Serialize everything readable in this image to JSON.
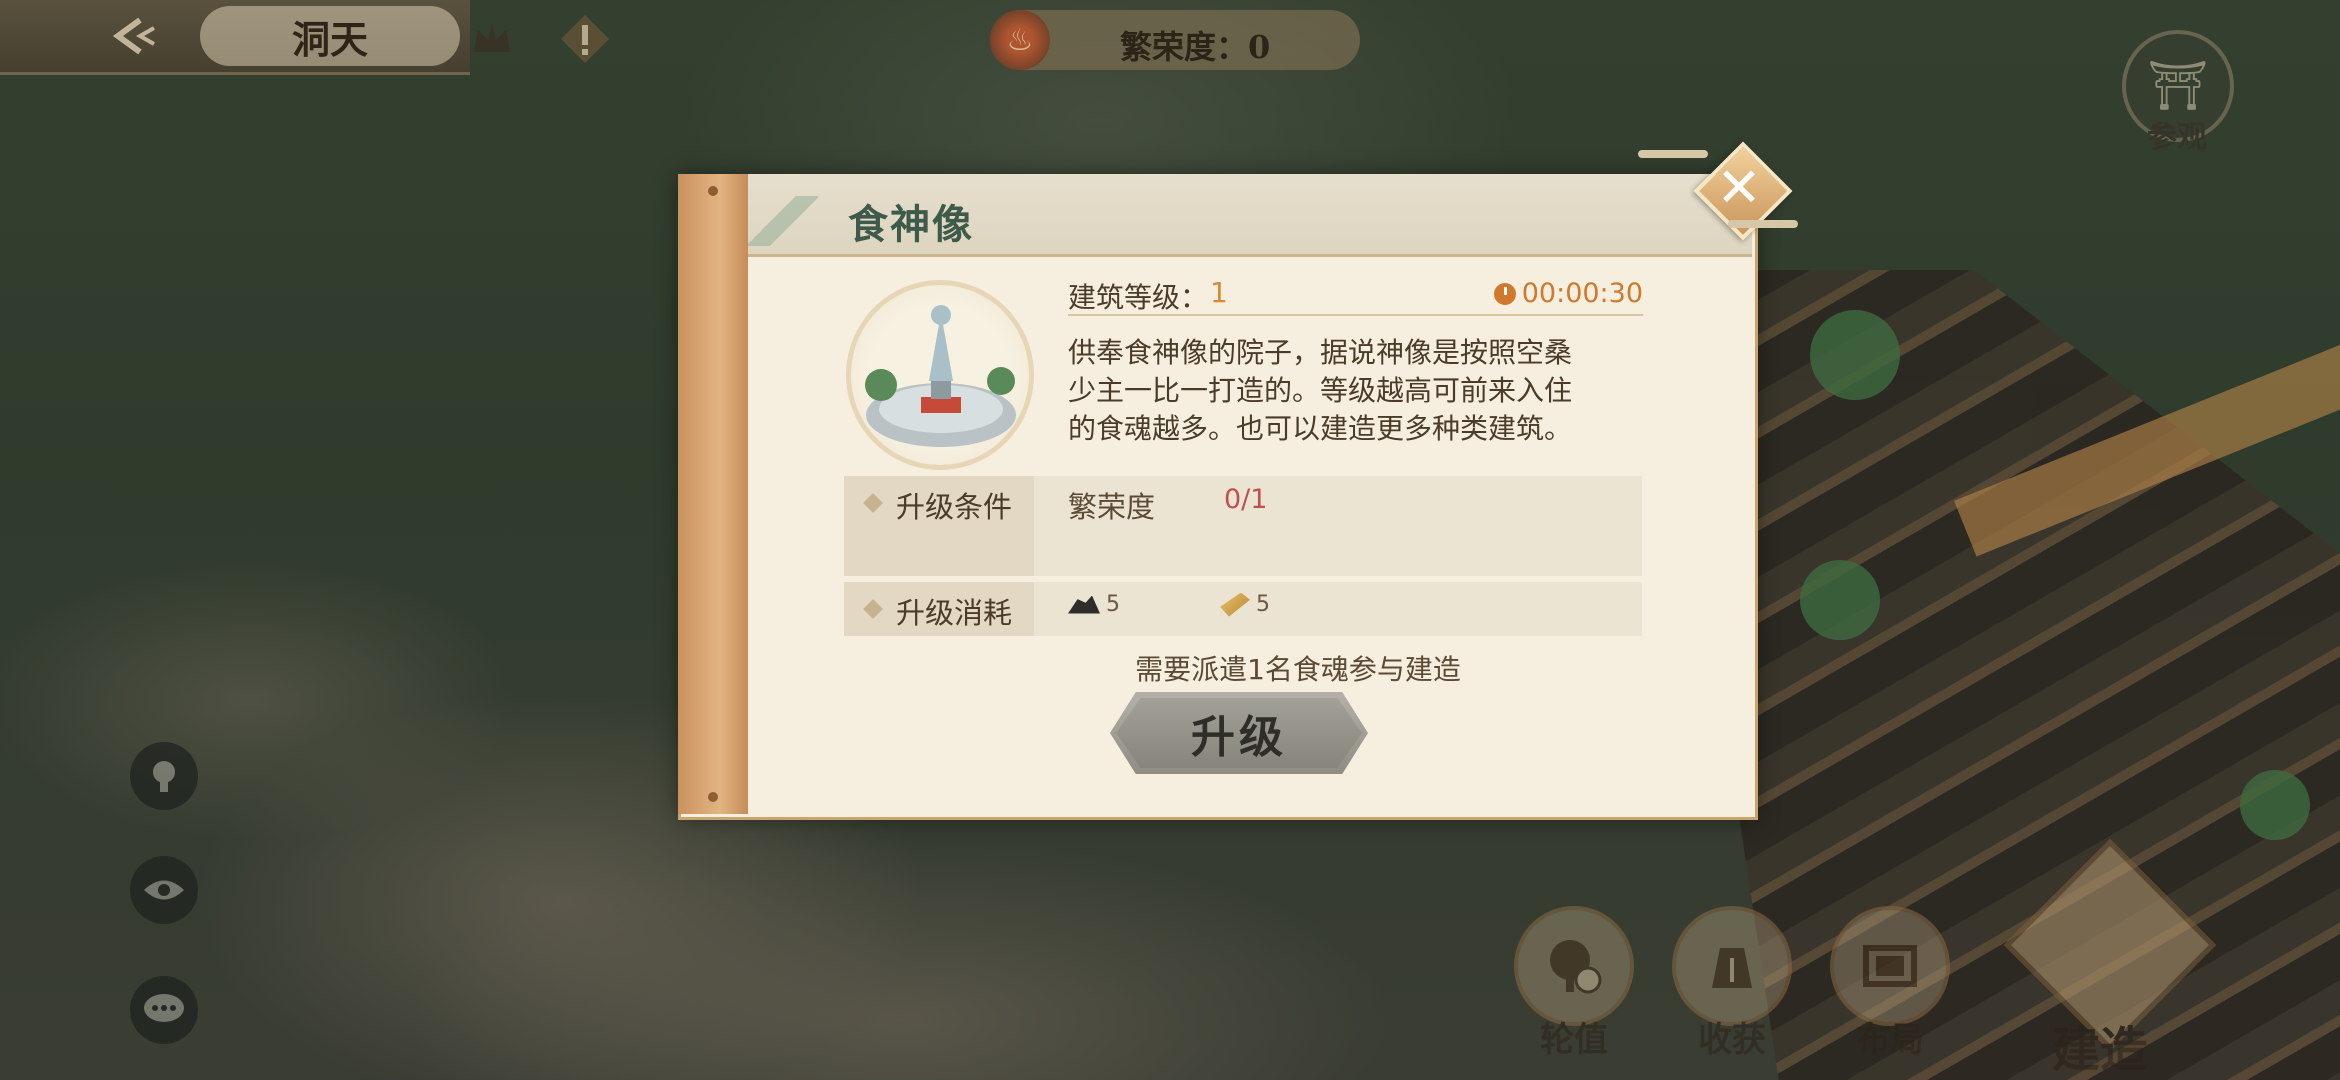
{
  "topbar": {
    "title": "洞天",
    "prosperity_text": "繁荣度：0",
    "visit_label": "参观",
    "icons": [
      "back-arrow-icon",
      "crown-icon",
      "alert-icon",
      "flame-icon",
      "gate-icon"
    ]
  },
  "side_buttons": [
    "avatar-icon",
    "eye-icon",
    "chat-icon"
  ],
  "bottom_menu": {
    "items": [
      {
        "label": "轮值",
        "icon": "tree-clock-icon"
      },
      {
        "label": "收获",
        "icon": "grain-sack-icon"
      },
      {
        "label": "布局",
        "icon": "layout-frame-icon"
      }
    ],
    "build_label": "建造"
  },
  "dialog": {
    "title": "食神像",
    "level_label": "建筑等级：",
    "level_value": "1",
    "timer": "00:00:30",
    "description_lines": [
      "供奉食神像的院子，据说神像是按照空桑",
      "少主一比一打造的。等级越高可前来入住",
      "的食魂越多。也可以建造更多种类建筑。"
    ],
    "condition_header": "升级条件",
    "condition_name": "繁荣度",
    "condition_value": "0/1",
    "cost_header": "升级消耗",
    "costs": [
      {
        "icon": "coal-icon",
        "amount": "5"
      },
      {
        "icon": "wood-icon",
        "amount": "5"
      }
    ],
    "dispatch_note": "需要派遣1名食魂参与建造",
    "upgrade_label": "升级",
    "accent_colors": {
      "level": "#d78a3a",
      "condition_value": "#c0504a",
      "title": "#3e5a4a"
    }
  }
}
